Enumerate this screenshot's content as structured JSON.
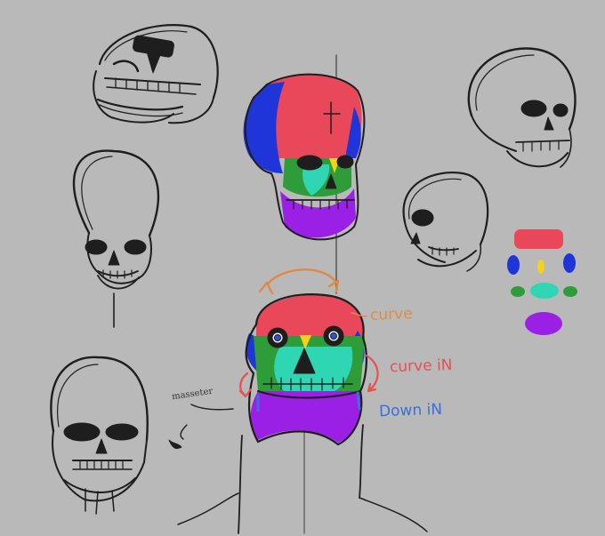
{
  "annotations": {
    "curve": "curve",
    "curve_in": "curve iN",
    "down_in": "Down iN",
    "side_note": "masseter"
  },
  "colors": {
    "background": "#b9b9b9",
    "ink": "#1e1e1e",
    "cranium_red": "#e8485a",
    "temporal_blue": "#2035d8",
    "eye_yellow": "#f2d21b",
    "cheek_green": "#2f9c3a",
    "maxilla_teal": "#2fd6b4",
    "mandible_purple": "#9b20e6",
    "arrow_orange": "#e08a4a",
    "annotation_red": "#e65050",
    "annotation_blue": "#3c6fd8"
  },
  "legend_swatches": [
    {
      "region": "cranium",
      "color": "#e8485a"
    },
    {
      "region": "temporal-left",
      "color": "#2035d8"
    },
    {
      "region": "nasal-point",
      "color": "#f2d21b"
    },
    {
      "region": "temporal-right",
      "color": "#2035d8"
    },
    {
      "region": "zygomatic-left",
      "color": "#2f9c3a"
    },
    {
      "region": "maxilla",
      "color": "#2fd6b4"
    },
    {
      "region": "zygomatic-right",
      "color": "#2f9c3a"
    },
    {
      "region": "mandible",
      "color": "#9b20e6"
    }
  ]
}
